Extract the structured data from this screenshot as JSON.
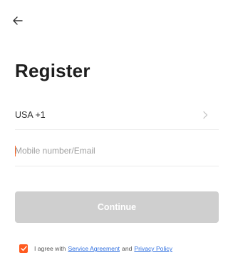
{
  "nav": {
    "back_icon": "back-arrow-icon"
  },
  "header": {
    "title": "Register"
  },
  "form": {
    "country": {
      "label": "USA +1",
      "icon": "chevron-right-icon"
    },
    "account_input": {
      "value": "",
      "placeholder": "Mobile number/Email"
    },
    "continue_label": "Continue"
  },
  "agreement": {
    "checked": true,
    "prefix": "I agree with",
    "service_link": "Service Agreement",
    "and_text": "and",
    "privacy_link": "Privacy Policy"
  },
  "colors": {
    "accent": "#ff5a1f",
    "link": "#2f6fe0",
    "button_disabled": "#cfcfcf",
    "title": "#1e1e1e"
  }
}
